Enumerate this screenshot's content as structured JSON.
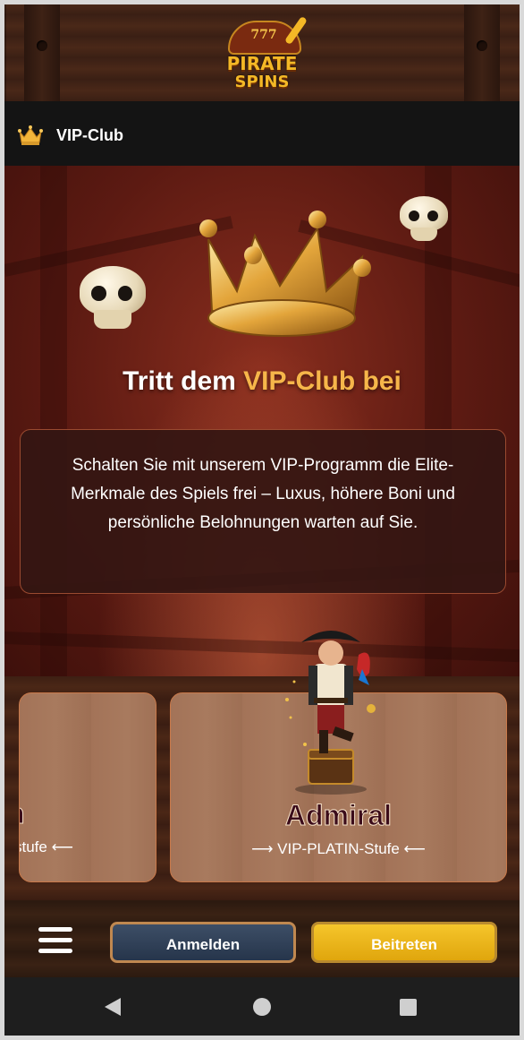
{
  "brand": {
    "sevens": "777",
    "line1": "PIRATE",
    "line2": "SPINS"
  },
  "navbar": {
    "title": "VIP-Club",
    "icon": "crown-icon"
  },
  "hero": {
    "title_prefix": "Tritt dem ",
    "title_accent": "VIP-Club bei",
    "description": "Schalten Sie mit unserem VIP-Programm die Elite-Merkmale des Spiels frei – Luxus, höhere Boni und persönliche Belohnungen warten auf Sie."
  },
  "cards": [
    {
      "name": "n",
      "subtitle": "stufe ⟵"
    },
    {
      "name": "Admiral",
      "subtitle": "⟶ VIP-PLATIN-Stufe ⟵"
    }
  ],
  "actions": {
    "menu_icon": "hamburger-menu-icon",
    "login_label": "Anmelden",
    "join_label": "Beitreten"
  },
  "colors": {
    "accent": "#f6b64a",
    "join": "#f5c52b",
    "login": "#2f3f57",
    "card_name": "#3b0c1a"
  },
  "system_nav": {
    "back_icon": "back-icon",
    "home_icon": "home-icon",
    "recents_icon": "recents-icon"
  }
}
